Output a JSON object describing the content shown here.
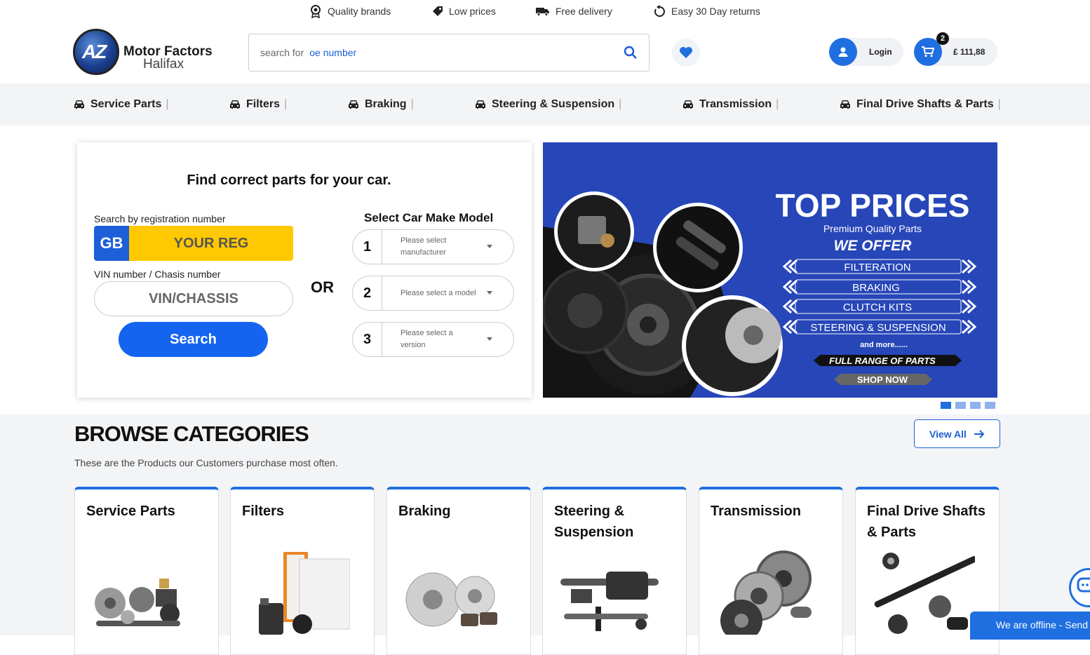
{
  "topstrip": {
    "items": [
      {
        "icon": "award-icon",
        "label": "Quality brands"
      },
      {
        "icon": "tag-icon",
        "label": "Low prices"
      },
      {
        "icon": "truck-icon",
        "label": "Free delivery"
      },
      {
        "icon": "rotate-icon",
        "label": "Easy 30 Day returns"
      }
    ]
  },
  "logo": {
    "badge": "AZ",
    "line1": "Motor Factors",
    "line2": "Halifax"
  },
  "search": {
    "prefix": "search for",
    "suffix": "oe number"
  },
  "account": {
    "login_label": "Login"
  },
  "cart": {
    "count": "2",
    "amount": "£ 111,88"
  },
  "nav": {
    "items": [
      {
        "label": "Service Parts"
      },
      {
        "label": "Filters"
      },
      {
        "label": "Braking"
      },
      {
        "label": "Steering & Suspension"
      },
      {
        "label": "Transmission"
      },
      {
        "label": "Final Drive Shafts & Parts"
      }
    ],
    "separator": "|"
  },
  "finder": {
    "title": "Find correct parts for your car.",
    "reg_label": "Search by registration number",
    "reg_country": "GB",
    "reg_placeholder": "YOUR REG",
    "vin_label": "VIN number / Chasis number",
    "vin_placeholder": "VIN/CHASSIS",
    "search_label": "Search",
    "or_label": "OR",
    "make_model_title": "Select Car Make Model",
    "selects": [
      {
        "num": "1",
        "text": "Please select manufacturer"
      },
      {
        "num": "2",
        "text": "Please select a model"
      },
      {
        "num": "3",
        "text": "Please select a version"
      }
    ]
  },
  "banner": {
    "headline": "TOP PRICES",
    "sub": "Premium  Quality Parts",
    "offer": "WE OFFER",
    "items": [
      "FILTERATION",
      "BRAKING",
      "CLUTCH KITS",
      "STEERING & SUSPENSION"
    ],
    "more": "and more......",
    "full_range": "FULL RANGE OF PARTS",
    "shop_now": "SHOP NOW",
    "active_slide": 1,
    "slide_count": 4
  },
  "browse": {
    "title": "BROWSE CATEGORIES",
    "subtitle": "These are the Products our Customers purchase most often.",
    "view_all": "View All",
    "cards": [
      {
        "title": "Service Parts"
      },
      {
        "title": "Filters"
      },
      {
        "title": "Braking"
      },
      {
        "title": "Steering & Suspension"
      },
      {
        "title": "Transmission"
      },
      {
        "title": "Final Drive Shafts & Parts"
      }
    ]
  },
  "chat": {
    "offline_label": "We are offline - Send"
  },
  "colors": {
    "accent": "#1f6fe0",
    "reg_yellow": "#ffc800",
    "banner_blue": "#2746b8"
  }
}
